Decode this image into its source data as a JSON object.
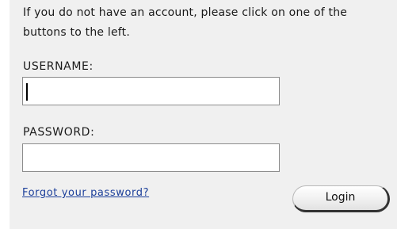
{
  "intro_text": "If you do not have an account, please click on one of the buttons to the left.",
  "username": {
    "label": "USERNAME:",
    "value": ""
  },
  "password": {
    "label": "PASSWORD:",
    "value": ""
  },
  "forgot_link": "Forgot your password?",
  "login_button": "Login",
  "colors": {
    "panel_background": "#f0f0f0",
    "link": "#1c3f9a"
  }
}
